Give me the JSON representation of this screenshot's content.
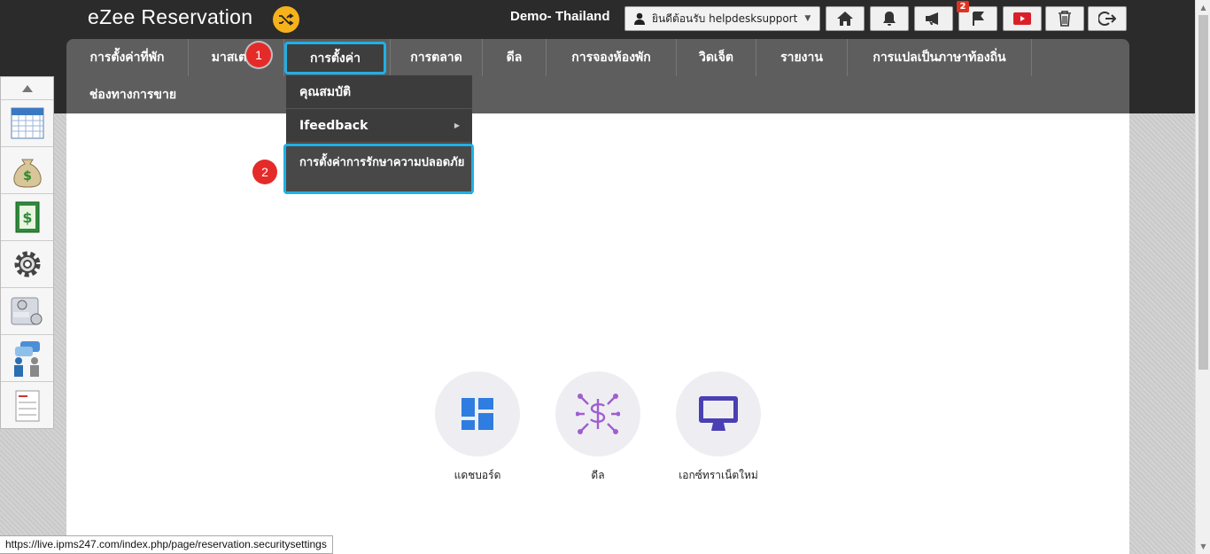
{
  "header": {
    "brand": "eZee Reservation",
    "hotel_name": "Demo- Thailand",
    "user_greeting": "ยินดีต้อนรับ helpdesksupport",
    "notification_count": "2",
    "icons": [
      "home-icon",
      "bell-icon",
      "megaphone-icon",
      "flag-icon",
      "youtube-icon",
      "trash-icon",
      "logout-icon"
    ]
  },
  "nav": {
    "items": [
      {
        "label": "การตั้งค่าที่พัก"
      },
      {
        "label": "มาสเตอร์"
      },
      {
        "label": "การตั้งค่า"
      },
      {
        "label": "การตลาด"
      },
      {
        "label": "ดีล"
      },
      {
        "label": "การจองห้องพัก"
      },
      {
        "label": "วิดเจ็ต"
      },
      {
        "label": "รายงาน"
      },
      {
        "label": "การแปลเป็นภาษาท้องถิ่น"
      }
    ],
    "row2": [
      {
        "label": "ช่องทางการขาย"
      }
    ],
    "active": "การตั้งค่า"
  },
  "dropdown": {
    "items": [
      {
        "label": "คุณสมบัติ"
      },
      {
        "label": "Ifeedback"
      },
      {
        "label": "การตั้งค่าการรักษาความปลอดภัย"
      }
    ]
  },
  "markers": {
    "one": "1",
    "two": "2"
  },
  "tiles": [
    {
      "label": "แดชบอร์ด",
      "icon": "dashboard-icon",
      "color": "#2f7de1"
    },
    {
      "label": "ดีล",
      "icon": "deal-icon",
      "color": "#a05ed0"
    },
    {
      "label": "เอกซ์ทราเน็ตใหม่",
      "icon": "monitor-icon",
      "color": "#4a3fb3"
    }
  ],
  "status_url": "https://live.ipms247.com/index.php/page/reservation.securitysettings",
  "colors": {
    "accent_ring": "#1fb0e6",
    "marker": "#e52a2a",
    "shuffle": "#f6b21b",
    "youtube": "#d9202a"
  }
}
